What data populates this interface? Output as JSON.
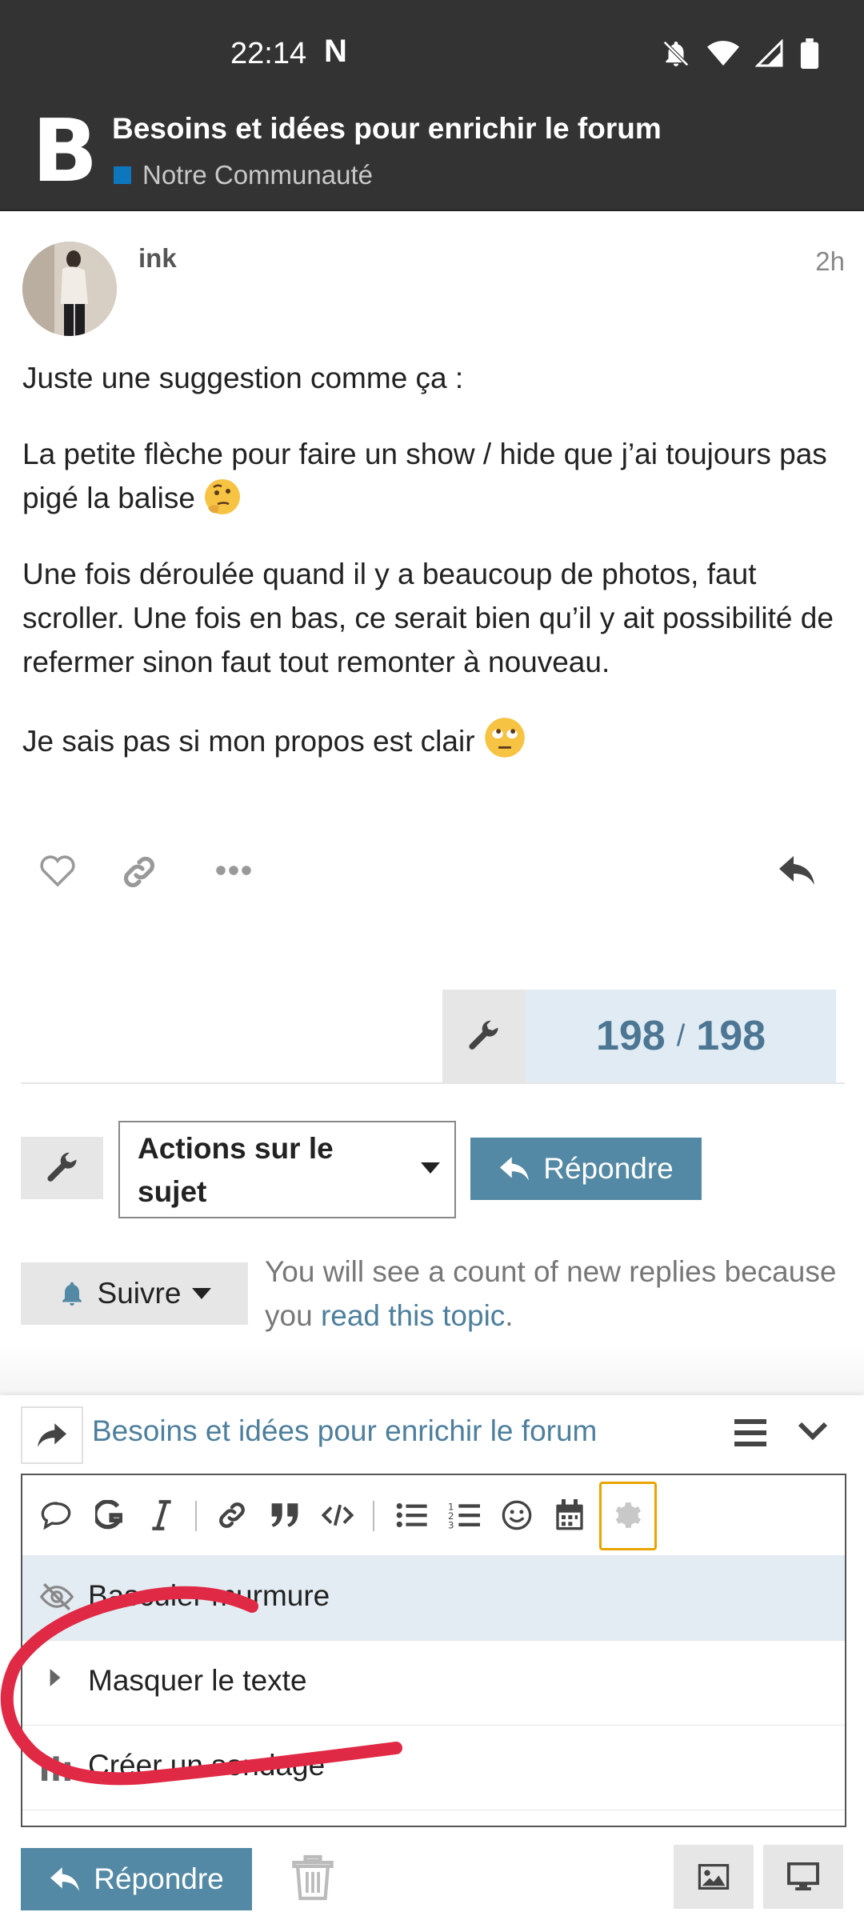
{
  "status_bar": {
    "time": "22:14",
    "notification_badge": "N",
    "icons": [
      "notifications-off-icon",
      "wifi-icon",
      "signal-icon",
      "battery-icon"
    ]
  },
  "header": {
    "logo_letter": "B",
    "topic_title": "Besoins et idées pour enrichir le forum",
    "category": "Notre Communauté",
    "category_color": "#0e76bd"
  },
  "post": {
    "username": "ink",
    "time": "2h",
    "paragraphs": {
      "p1": "Juste une suggestion comme ça :",
      "p2": "La petite flèche pour faire un show / hide que j’ai toujours pas pigé la balise",
      "p3": "Une fois déroulée quand il y a beaucoup de photos, faut scroller. Une fois en bas, ce serait bien qu’il y ait possibilité de refermer sinon faut tout remonter à nouveau.",
      "p4": "Je sais pas si mon propos est clair"
    },
    "actions": [
      "like-icon",
      "link-icon",
      "more-icon",
      "reply-icon"
    ]
  },
  "timeline": {
    "current": "198",
    "separator": "/",
    "total": "198"
  },
  "topic_footer": {
    "actions_select_label": "Actions sur le sujet",
    "reply_label": "Répondre",
    "follow_label": "Suivre",
    "follow_text": "You will see a count of new replies because you",
    "follow_link": "read this topic",
    "follow_end": "."
  },
  "composer": {
    "title": "Besoins et idées pour enrichir le forum",
    "toolbar": [
      "quote-icon",
      "bold-icon",
      "italic-icon",
      "link-icon",
      "blockquote-icon",
      "code-icon",
      "bullet-list-icon",
      "numbered-list-icon",
      "emoji-icon",
      "calendar-icon",
      "gear-icon"
    ],
    "popup_menu": [
      {
        "label": "Basculer murmure",
        "icon": "eye-slash-icon"
      },
      {
        "label": "Masquer le texte",
        "icon": "caret-right-icon"
      },
      {
        "label": "Créer un sondage",
        "icon": "chart-bar-icon"
      }
    ],
    "reply_label": "Répondre"
  },
  "colors": {
    "header_bg": "#333333",
    "button_blue": "#5389a4",
    "highlight": "#e9a400",
    "annotation_red": "#e02a45"
  }
}
